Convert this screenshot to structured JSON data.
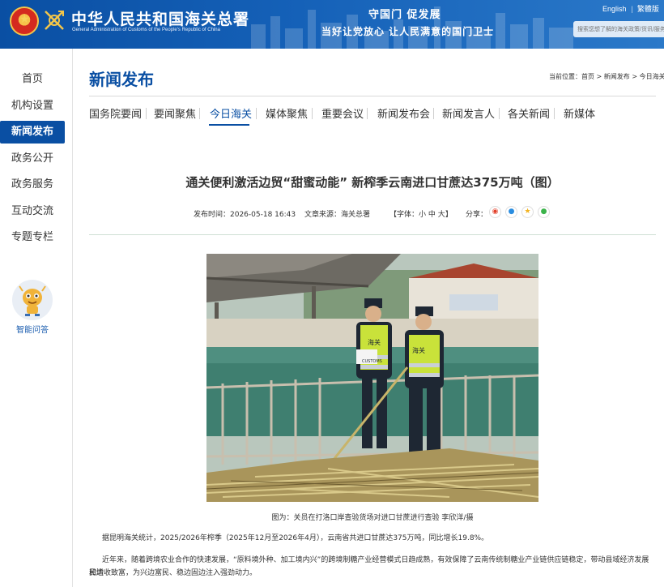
{
  "header": {
    "site_title": "中华人民共和国海关总署",
    "site_subtitle": "General Administration of Customs of the People's Republic of China",
    "slogan_line1": "守国门  促发展",
    "slogan_line2": "当好让党放心   让人民满意的国门卫士",
    "lang_english": "English",
    "lang_traditional": "繁體版",
    "search_placeholder": "搜索您想了解的海关政策/货讯/服务"
  },
  "sidebar": {
    "items": [
      {
        "label": "首页"
      },
      {
        "label": "机构设置"
      },
      {
        "label": "新闻发布"
      },
      {
        "label": "政务公开"
      },
      {
        "label": "政务服务"
      },
      {
        "label": "互动交流"
      },
      {
        "label": "专题专栏"
      }
    ],
    "active_index": 2,
    "assistant_label": "智能问答"
  },
  "main": {
    "page_title": "新闻发布",
    "breadcrumb": "当前位置：首页 > 新闻发布 > 今日海关",
    "tabs": [
      {
        "label": "国务院要闻"
      },
      {
        "label": "要闻聚焦"
      },
      {
        "label": "今日海关"
      },
      {
        "label": "媒体聚焦"
      },
      {
        "label": "重要会议"
      },
      {
        "label": "新闻发布会"
      },
      {
        "label": "新闻发言人"
      },
      {
        "label": "各关新闻"
      },
      {
        "label": "新媒体"
      }
    ],
    "active_tab": 2
  },
  "article": {
    "title": "通关便利激活边贸“甜蜜动能” 新榨季云南进口甘蔗达375万吨（图）",
    "publish_time": "发布时间：2026-05-18 16:43",
    "source": "文章来源：海关总署",
    "font_label": "【字体：",
    "font_small": "小",
    "font_medium": "中",
    "font_large": "大",
    "font_close": "】",
    "share_label": "分享：",
    "caption": "图为：关员在打洛口岸查验货场对进口甘蔗进行查验 李欣洋/摄",
    "paragraph1": "据昆明海关统计，2025/2026年榨季（2025年12月至2026年4月），云南省共进口甘蔗达375万吨，同比增长19.8%。",
    "paragraph2_line1": "近年来，随着跨境农业合作的快速发展，“原料境外种、加工境内兴”的跨境制糖产业经营模式日趋成熟，有效保障了云南传统制糖业产业链供应链稳定，带动县域经济发展和边",
    "paragraph2_line2": "民增收致富，为兴边富民、稳边固边注入强劲动力。",
    "vest_text_left": "海关",
    "vest_text_badge": "CUSTOMS",
    "vest_text_right": "海关"
  },
  "colors": {
    "brand_blue": "#0a4fa3",
    "header_gradient_end": "#2b79c9"
  },
  "icons": {
    "share": [
      "weibo-icon",
      "qq-icon",
      "qzone-icon",
      "wechat-icon"
    ]
  }
}
